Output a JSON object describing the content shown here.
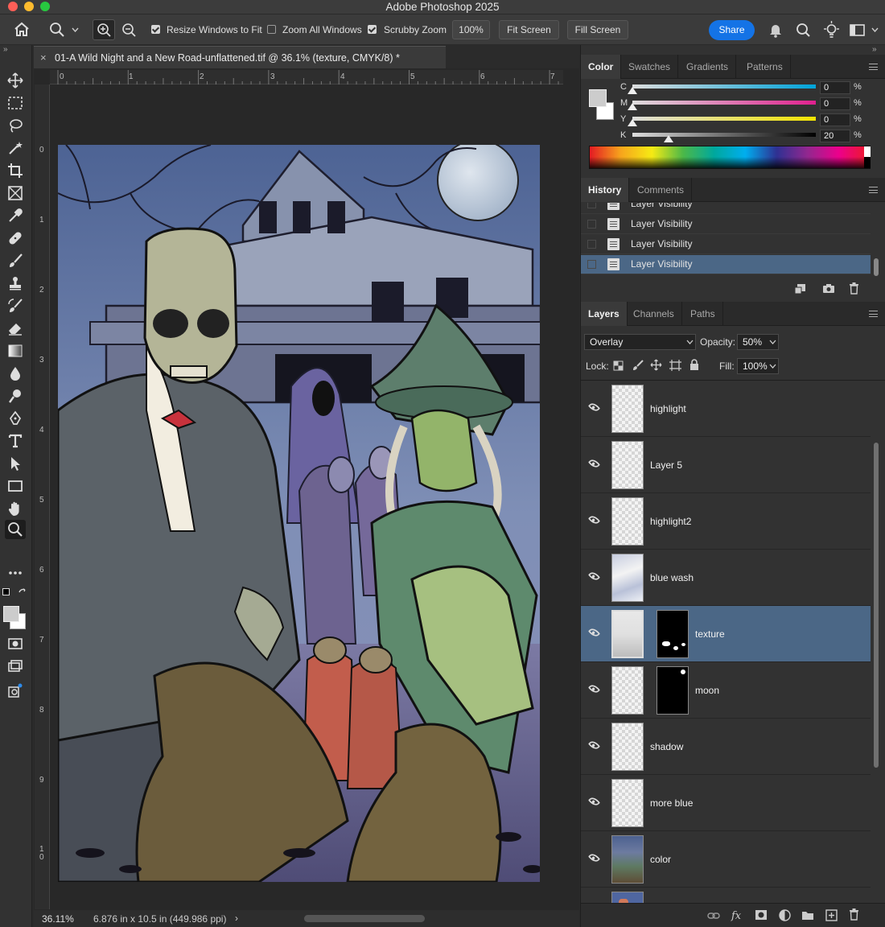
{
  "app": {
    "window_title": "Adobe Photoshop 2025"
  },
  "options_bar": {
    "resize_windows_label": "Resize Windows to Fit",
    "zoom_all_label": "Zoom All Windows",
    "scrubby_zoom_label": "Scrubby Zoom",
    "zoom_percent": "100%",
    "fit_screen_label": "Fit Screen",
    "fill_screen_label": "Fill Screen",
    "share_label": "Share",
    "resize_windows_checked": true,
    "zoom_all_checked": false,
    "scrubby_zoom_checked": true
  },
  "document": {
    "tab_title": "01-A Wild Night and a New Road-unflattened.tif @ 36.1% (texture, CMYK/8) *",
    "close_glyph": "×"
  },
  "rulers": {
    "horizontal": [
      "0",
      "1",
      "2",
      "3",
      "4",
      "5",
      "6",
      "7"
    ],
    "vertical": [
      "0",
      "1",
      "2",
      "3",
      "4",
      "5",
      "6",
      "7",
      "8",
      "9",
      "1\n0"
    ]
  },
  "status": {
    "zoom": "36.11%",
    "doc_info": "6.876 in x 10.5 in (449.986 ppi)",
    "arrow": "›"
  },
  "color_panel": {
    "tabs": [
      "Color",
      "Swatches",
      "Gradients",
      "Patterns"
    ],
    "sliders": [
      {
        "letter": "C",
        "value": "0",
        "unit": "%",
        "position": 0.0,
        "color": "#00a3d9"
      },
      {
        "letter": "M",
        "value": "0",
        "unit": "%",
        "position": 0.0,
        "color": "#e0208e"
      },
      {
        "letter": "Y",
        "value": "0",
        "unit": "%",
        "position": 0.0,
        "color": "#f2e400"
      },
      {
        "letter": "K",
        "value": "20",
        "unit": "%",
        "position": 0.2,
        "color": "#000000"
      }
    ]
  },
  "history_panel": {
    "tabs": [
      "History",
      "Comments"
    ],
    "items": [
      "Layer Visibility",
      "Layer Visibility",
      "Layer Visibility",
      "Layer Visibility"
    ]
  },
  "layers_panel": {
    "tabs": [
      "Layers",
      "Channels",
      "Paths"
    ],
    "blend_mode": "Overlay",
    "opacity_label": "Opacity:",
    "opacity": "50%",
    "lock_label": "Lock:",
    "fill_label": "Fill:",
    "fill": "100%",
    "layers": [
      {
        "name": "highlight",
        "mask": false,
        "selected": false
      },
      {
        "name": "Layer 5",
        "mask": false,
        "selected": false
      },
      {
        "name": "highlight2",
        "mask": false,
        "selected": false
      },
      {
        "name": "blue wash",
        "mask": false,
        "selected": false
      },
      {
        "name": "texture",
        "mask": true,
        "selected": true
      },
      {
        "name": "moon",
        "mask": true,
        "selected": false
      },
      {
        "name": "shadow",
        "mask": false,
        "selected": false
      },
      {
        "name": "more blue",
        "mask": false,
        "selected": false
      },
      {
        "name": "color",
        "mask": false,
        "selected": false
      }
    ]
  },
  "accent": {
    "share_blue": "#1473e6",
    "selection_blue": "#4b6786"
  }
}
